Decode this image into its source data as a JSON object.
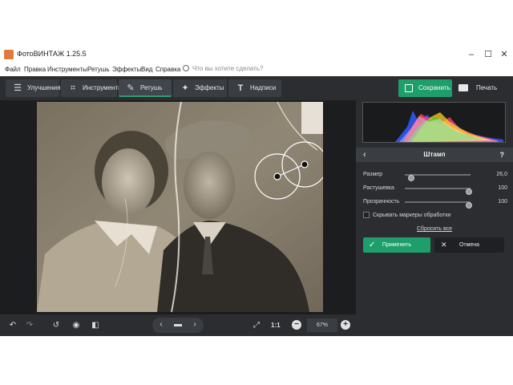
{
  "window": {
    "title": "ФотоВИНТАЖ 1.25.5",
    "minimize": "–",
    "maximize": "☐",
    "close": "✕"
  },
  "menu": {
    "items": [
      "Файл",
      "Правка",
      "Инструменты",
      "Ретушь",
      "Эффекты",
      "Вид",
      "Справка"
    ],
    "search_placeholder": "Что вы хотите сделать?"
  },
  "toolbar": {
    "tabs": [
      {
        "label": "Улучшения",
        "icon": "sliders-icon"
      },
      {
        "label": "Инструменты",
        "icon": "crop-icon"
      },
      {
        "label": "Ретушь",
        "icon": "brush-icon",
        "active": true
      },
      {
        "label": "Эффекты",
        "icon": "magic-wand-icon"
      },
      {
        "label": "Надписи",
        "icon": "text-icon"
      }
    ],
    "save_label": "Сохранить",
    "print_label": "Печать"
  },
  "panel": {
    "title": "Штамп",
    "help": "?",
    "sliders": [
      {
        "label": "Размер",
        "value": "26,0",
        "fraction": 0.05
      },
      {
        "label": "Растушевка",
        "value": "100",
        "fraction": 1.0
      },
      {
        "label": "Прозрачность",
        "value": "100",
        "fraction": 1.0
      }
    ],
    "hide_markers_label": "Скрывать маркеры обработки",
    "reset_label": "Сбросить все",
    "apply_label": "Применить",
    "cancel_label": "Отмена"
  },
  "bottombar": {
    "ratio_label": "1:1",
    "zoom_value": "67%"
  },
  "colors": {
    "accent": "#1e9e6a",
    "dark_bg": "#2b2d30",
    "canvas_bg": "#1c1d1f"
  }
}
